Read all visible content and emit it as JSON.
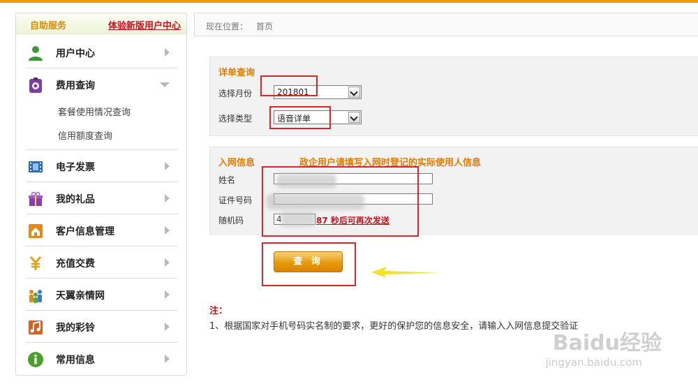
{
  "sidebar": {
    "title": "自助服务",
    "new_center_link": "体验新版用户中心",
    "items": [
      {
        "label": "用户中心",
        "icon": "user-icon"
      },
      {
        "label": "费用查询",
        "icon": "bill-icon"
      },
      {
        "label": "电子发票",
        "icon": "film-icon"
      },
      {
        "label": "我的礼品",
        "icon": "gift-icon"
      },
      {
        "label": "客户信息管理",
        "icon": "home-icon"
      },
      {
        "label": "充值交费",
        "icon": "yuan-icon"
      },
      {
        "label": "天翼亲情网",
        "icon": "family-icon"
      },
      {
        "label": "我的彩铃",
        "icon": "music-icon"
      },
      {
        "label": "常用信息",
        "icon": "info-icon"
      }
    ],
    "subitems": [
      "套餐使用情况查询",
      "信用额度查询"
    ]
  },
  "breadcrumb": {
    "label": "现在位置：",
    "current": "首页"
  },
  "detail": {
    "title": "详单查询",
    "month_label": "选择月份",
    "month_value": "201801",
    "type_label": "选择类型",
    "type_value": "语音详单"
  },
  "netinfo": {
    "title": "入网信息",
    "notice": "政企用户请填写入网时登记的实际使用人信息",
    "name_label": "姓名",
    "id_label": "证件号码",
    "code_label": "随机码",
    "code_value": "4",
    "countdown": "87 秒后可再次发送"
  },
  "query_button": "查 询",
  "notes": {
    "title": "注：",
    "line1": "1、根据国家对手机号码实名制的要求，更好的保护您的信息安全，请输入入网信息提交验证"
  },
  "watermark": {
    "brand": "Baidu经验",
    "url": "jingyan.baidu.com"
  },
  "colors": {
    "accent": "#f39800",
    "link_red": "#c8101d",
    "highlight_box": "#d9242b"
  }
}
